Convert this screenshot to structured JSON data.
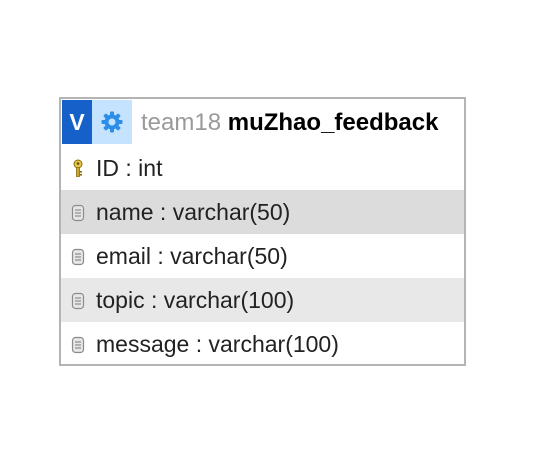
{
  "header": {
    "v_label": "V",
    "schema": "team18",
    "table_name": "muZhao_feedback"
  },
  "columns": [
    {
      "text": "ID : int",
      "icon": "key-icon"
    },
    {
      "text": "name : varchar(50)",
      "icon": "column-icon"
    },
    {
      "text": "email : varchar(50)",
      "icon": "column-icon"
    },
    {
      "text": "topic : varchar(100)",
      "icon": "column-icon"
    },
    {
      "text": "message : varchar(100)",
      "icon": "column-icon"
    }
  ],
  "colors": {
    "v_button": "#1561c9",
    "gear_button": "#c5e3ff",
    "row_shade_dark": "#dcdcdc",
    "row_shade_light": "#e8e8e8",
    "border": "#b4b4b4"
  }
}
